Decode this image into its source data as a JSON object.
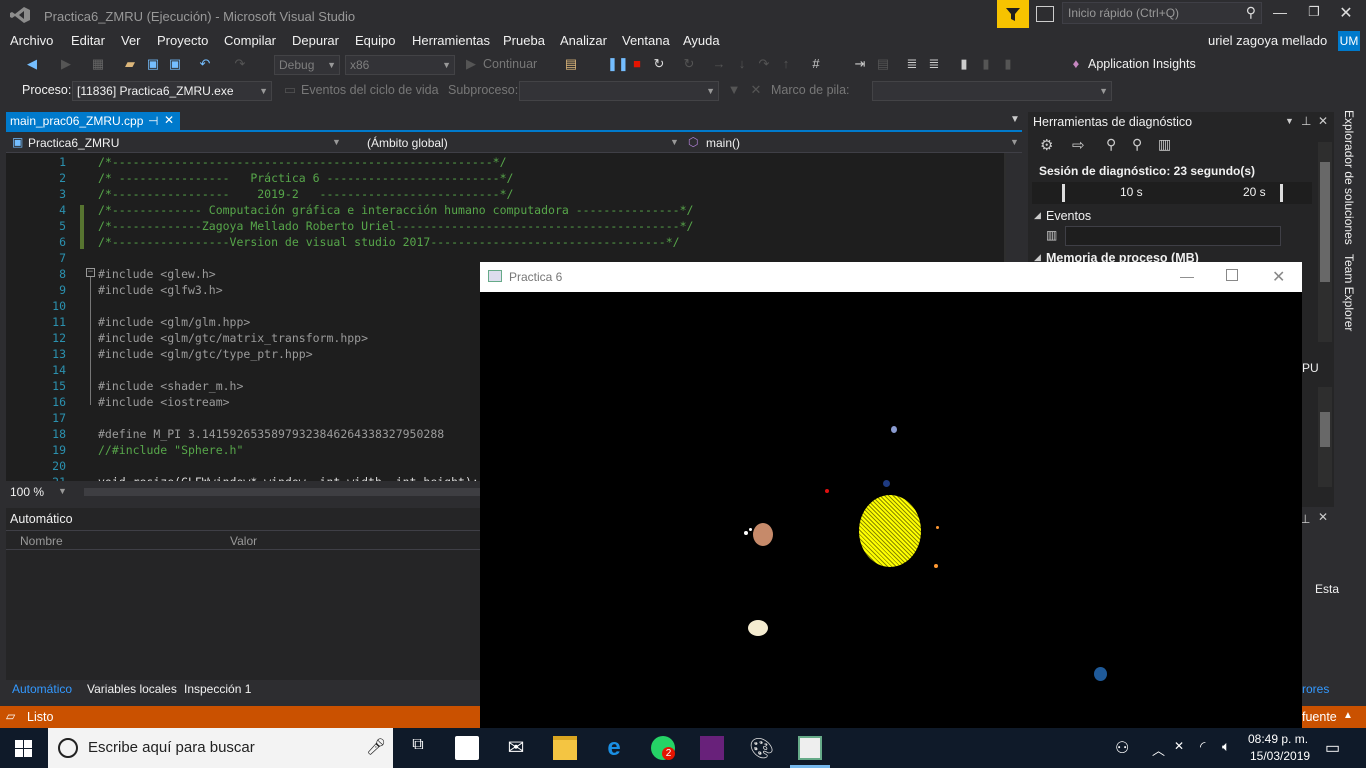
{
  "window": {
    "title": "Practica6_ZMRU (Ejecución) - Microsoft Visual Studio",
    "quick_launch": "Inicio rápido (Ctrl+Q)",
    "user": "uriel zagoya mellado",
    "user_initials": "UM"
  },
  "menu": [
    "Archivo",
    "Editar",
    "Ver",
    "Proyecto",
    "Compilar",
    "Depurar",
    "Equipo",
    "Herramientas",
    "Prueba",
    "Analizar",
    "Ventana",
    "Ayuda"
  ],
  "toolbar": {
    "config": "Debug",
    "platform": "x86",
    "continue": "Continuar",
    "app_insights": "Application Insights"
  },
  "toolbar2": {
    "process_label": "Proceso:",
    "process_value": "[11836] Practica6_ZMRU.exe",
    "lifecycle": "Eventos del ciclo de vida",
    "thread_label": "Subproceso:",
    "stack_label": "Marco de pila:"
  },
  "editor": {
    "tab": "main_prac06_ZMRU.cpp",
    "nav_project": "Practica6_ZMRU",
    "nav_scope": "(Ámbito global)",
    "nav_member": "main()",
    "zoom": "100 %",
    "lines": [
      {
        "n": "1",
        "text": "/*-------------------------------------------------------*/",
        "cls": "c-comment"
      },
      {
        "n": "2",
        "text": "/* ----------------   Práctica 6 -------------------------*/",
        "cls": "c-comment"
      },
      {
        "n": "3",
        "text": "/*-----------------    2019-2   --------------------------*/",
        "cls": "c-comment"
      },
      {
        "n": "4",
        "text": "/*------------- Computación gráfica e interacción humano computadora ---------------*/",
        "cls": "c-comment"
      },
      {
        "n": "5",
        "text": "/*-------------Zagoya Mellado Roberto Uriel-----------------------------------------*/",
        "cls": "c-comment"
      },
      {
        "n": "6",
        "text": "/*-----------------Version de visual studio 2017----------------------------------*/",
        "cls": "c-comment"
      },
      {
        "n": "7",
        "text": "",
        "cls": "c-plain"
      },
      {
        "n": "8",
        "text": "#include <glew.h>",
        "cls": "c-pp"
      },
      {
        "n": "9",
        "text": "#include <glfw3.h>",
        "cls": "c-pp"
      },
      {
        "n": "10",
        "text": "",
        "cls": "c-plain"
      },
      {
        "n": "11",
        "text": "#include <glm/glm.hpp>",
        "cls": "c-pp"
      },
      {
        "n": "12",
        "text": "#include <glm/gtc/matrix_transform.hpp>",
        "cls": "c-pp"
      },
      {
        "n": "13",
        "text": "#include <glm/gtc/type_ptr.hpp>",
        "cls": "c-pp"
      },
      {
        "n": "14",
        "text": "",
        "cls": "c-plain"
      },
      {
        "n": "15",
        "text": "#include <shader_m.h>",
        "cls": "c-pp"
      },
      {
        "n": "16",
        "text": "#include <iostream>",
        "cls": "c-pp"
      },
      {
        "n": "17",
        "text": "",
        "cls": "c-plain"
      },
      {
        "n": "18",
        "text": "#define M_PI 3.14159265358979323846264338327950288",
        "cls": "c-pp"
      },
      {
        "n": "19",
        "text": "//#include \"Sphere.h\"",
        "cls": "c-comment"
      },
      {
        "n": "20",
        "text": "",
        "cls": "c-plain"
      },
      {
        "n": "21",
        "text": "void resize(GLFWwindow* window, int width, int height);",
        "cls": "c-plain"
      }
    ]
  },
  "auto_panel": {
    "title": "Automático",
    "col_name": "Nombre",
    "col_value": "Valor",
    "tabs": [
      "Automático",
      "Variables locales",
      "Inspección 1"
    ]
  },
  "diagnostics": {
    "title": "Herramientas de diagnóstico",
    "session": "Sesión de diagnóstico: 23 segundo(s)",
    "tick_10": "10 s",
    "tick_20": "20 s",
    "events": "Eventos",
    "memory": "Memoria de proceso (MB)",
    "cpu_fragment": "PU",
    "esta_fragment": "Esta",
    "errors_fragment": "rores"
  },
  "right_strip": [
    "Explorador de soluciones",
    "Team Explorer"
  ],
  "status": {
    "text": "Listo",
    "right": "fuente"
  },
  "ogl_window": {
    "title": "Practica 6"
  },
  "taskbar": {
    "search": "Escribe aquí para buscar",
    "time": "08:49 p. m.",
    "date": "15/03/2019",
    "whatsapp_badge": "2"
  }
}
